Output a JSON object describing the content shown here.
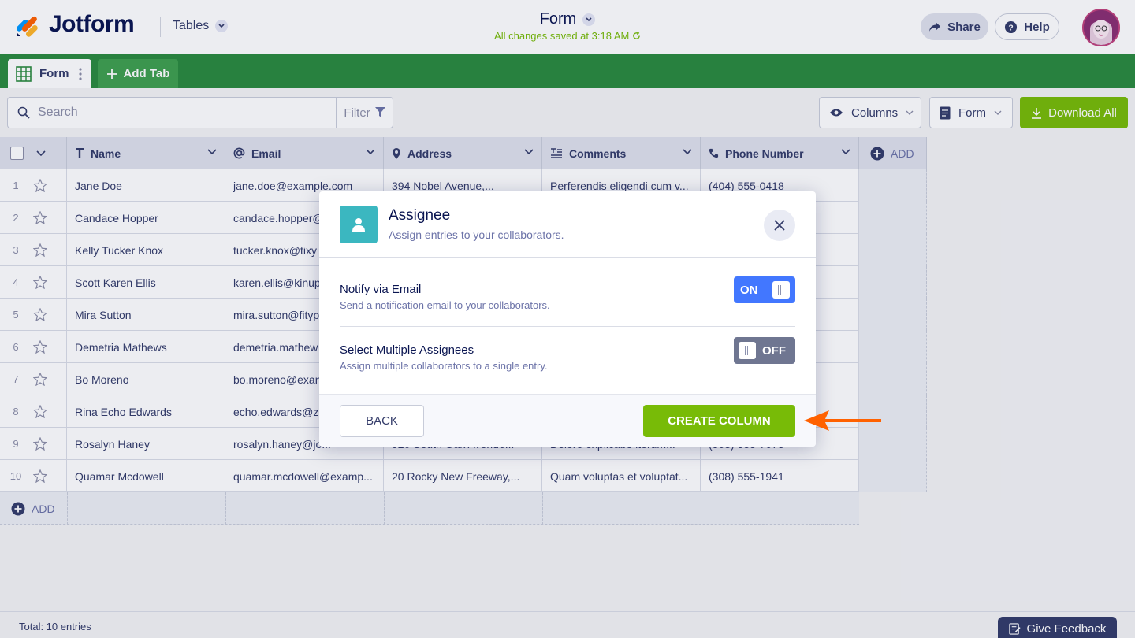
{
  "header": {
    "logo_text": "Jotform",
    "tables_label": "Tables",
    "form_title": "Form",
    "saved_status": "All changes saved at 3:18 AM",
    "share_label": "Share",
    "help_label": "Help"
  },
  "tabs": {
    "form_tab_label": "Form",
    "add_tab_label": "Add Tab"
  },
  "toolbar": {
    "search_placeholder": "Search",
    "filter_label": "Filter",
    "columns_label": "Columns",
    "form_select_label": "Form",
    "download_label": "Download All"
  },
  "table": {
    "columns": [
      "Name",
      "Email",
      "Address",
      "Comments",
      "Phone Number"
    ],
    "add_column_label": "ADD",
    "add_row_label": "ADD",
    "rows": [
      {
        "num": "1",
        "name": "Jane Doe",
        "email": "jane.doe@example.com",
        "address": "394 Nobel Avenue,...",
        "comments": "Perferendis eligendi cum v...",
        "phone": "(404) 555-0418"
      },
      {
        "num": "2",
        "name": "Candace Hopper",
        "email": "candace.hopper@",
        "address": "",
        "comments": "",
        "phone": ""
      },
      {
        "num": "3",
        "name": "Kelly Tucker Knox",
        "email": "tucker.knox@tixy",
        "address": "",
        "comments": "",
        "phone": ""
      },
      {
        "num": "4",
        "name": "Scott Karen Ellis",
        "email": "karen.ellis@kinup",
        "address": "",
        "comments": "",
        "phone": ""
      },
      {
        "num": "5",
        "name": "Mira Sutton",
        "email": "mira.sutton@fityp",
        "address": "",
        "comments": "",
        "phone": ""
      },
      {
        "num": "6",
        "name": "Demetria Mathews",
        "email": "demetria.mathew",
        "address": "",
        "comments": "",
        "phone": ""
      },
      {
        "num": "7",
        "name": "Bo Moreno",
        "email": "bo.moreno@exan",
        "address": "",
        "comments": "",
        "phone": ""
      },
      {
        "num": "8",
        "name": "Rina Echo Edwards",
        "email": "echo.edwards@zu",
        "address": "",
        "comments": "",
        "phone": ""
      },
      {
        "num": "9",
        "name": "Rosalyn Haney",
        "email": "rosalyn.haney@jo...",
        "address": "920 South Oak Avenue...",
        "comments": "Dolore explicabo iterum...",
        "phone": "(303) 555-7073"
      },
      {
        "num": "10",
        "name": "Quamar Mcdowell",
        "email": "quamar.mcdowell@examp...",
        "address": "20 Rocky New Freeway,...",
        "comments": "Quam voluptas et voluptat...",
        "phone": "(308) 555-1941"
      }
    ]
  },
  "footer": {
    "total_entries": "Total: 10 entries",
    "feedback_label": "Give Feedback"
  },
  "modal": {
    "title": "Assignee",
    "subtitle": "Assign entries to your collaborators.",
    "notify_title": "Notify via Email",
    "notify_desc": "Send a notification email to your collaborators.",
    "notify_state": "ON",
    "multi_title": "Select Multiple Assignees",
    "multi_desc": "Assign multiple collaborators to a single entry.",
    "multi_state": "OFF",
    "back_label": "BACK",
    "create_label": "CREATE COLUMN"
  },
  "colors": {
    "brand_green": "#2b8a3e",
    "accent_lime": "#78bb07",
    "toggle_on": "#4277ff",
    "toggle_off": "#6f7691",
    "modal_icon": "#3bb7c0",
    "arrow": "#ff6100"
  }
}
